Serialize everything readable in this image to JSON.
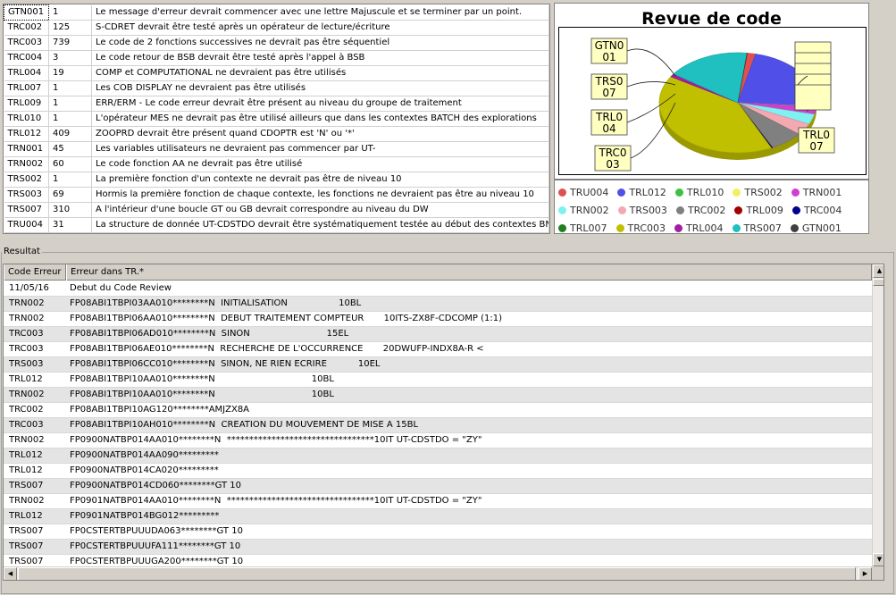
{
  "rules": [
    {
      "code": "GTN001",
      "count": "1",
      "message": "Le message d'erreur devrait commencer avec une lettre Majuscule et se terminer par un point."
    },
    {
      "code": "TRC002",
      "count": "125",
      "message": "S-CDRET devrait être testé après un opérateur de lecture/écriture"
    },
    {
      "code": "TRC003",
      "count": "739",
      "message": "Le code de 2 fonctions successives ne devrait pas être séquentiel"
    },
    {
      "code": "TRC004",
      "count": "3",
      "message": "Le code retour de BSB devrait être testé après l'appel à BSB"
    },
    {
      "code": "TRL004",
      "count": "19",
      "message": "COMP et COMPUTATIONAL ne devraient pas être utilisés"
    },
    {
      "code": "TRL007",
      "count": "1",
      "message": "Les COB DISPLAY ne devraient pas être utilisés"
    },
    {
      "code": "TRL009",
      "count": "1",
      "message": "ERR/ERM - Le code erreur devrait être présent au niveau du groupe de traitement"
    },
    {
      "code": "TRL010",
      "count": "1",
      "message": "L'opérateur MES ne devrait pas être utilisé ailleurs que dans les contextes BATCH des explorations"
    },
    {
      "code": "TRL012",
      "count": "409",
      "message": "ZOOPRD devrait être présent quand CDOPTR est 'N' ou '*'"
    },
    {
      "code": "TRN001",
      "count": "45",
      "message": "Les variables utilisateurs ne devraient pas commencer par UT-"
    },
    {
      "code": "TRN002",
      "count": "60",
      "message": "Le code fonction AA ne devrait pas être utilisé"
    },
    {
      "code": "TRS002",
      "count": "1",
      "message": "La première fonction d'un contexte ne devrait pas être de niveau 10"
    },
    {
      "code": "TRS003",
      "count": "69",
      "message": "Hormis la première fonction de chaque contexte, les fonctions ne devraient pas être au niveau 10"
    },
    {
      "code": "TRS007",
      "count": "310",
      "message": "A l'intérieur d'une boucle GT ou GB devrait correspondre au niveau du DW"
    },
    {
      "code": "TRU004",
      "count": "31",
      "message": "La structure de donnée UT-CDSTDO devrait être systématiquement testée au début des contextes BNK"
    }
  ],
  "chart_data": {
    "type": "pie",
    "title": "Revue de code",
    "series": [
      {
        "name": "TRU004",
        "value": 31,
        "color": "#e05050"
      },
      {
        "name": "TRL012",
        "value": 409,
        "color": "#5050e8"
      },
      {
        "name": "TRL010",
        "value": 1,
        "color": "#40c040"
      },
      {
        "name": "TRS002",
        "value": 1,
        "color": "#f0f060"
      },
      {
        "name": "TRN001",
        "value": 45,
        "color": "#d040d0"
      },
      {
        "name": "TRN002",
        "value": 60,
        "color": "#80f0f0"
      },
      {
        "name": "TRS003",
        "value": 69,
        "color": "#f4a8b0"
      },
      {
        "name": "TRC002",
        "value": 125,
        "color": "#808080"
      },
      {
        "name": "TRL009",
        "value": 1,
        "color": "#a00000"
      },
      {
        "name": "TRC004",
        "value": 3,
        "color": "#000090"
      },
      {
        "name": "TRL007",
        "value": 1,
        "color": "#208020"
      },
      {
        "name": "TRC003",
        "value": 739,
        "color": "#c0c000"
      },
      {
        "name": "TRL004",
        "value": 19,
        "color": "#a020a0"
      },
      {
        "name": "TRS007",
        "value": 310,
        "color": "#20c0c0"
      },
      {
        "name": "GTN001",
        "value": 1,
        "color": "#404040"
      }
    ],
    "callouts_left": [
      "GTN001",
      "TRS007",
      "TRL004",
      "TRC003"
    ],
    "callouts_right": [
      "TRL007",
      "",
      "",
      "",
      "",
      ""
    ],
    "legend_placement": "bottom"
  },
  "legend_rows": [
    [
      "TRU004",
      "TRL012",
      "TRL010",
      "TRS002",
      "TRN001"
    ],
    [
      "TRN002",
      "TRS003",
      "TRC002",
      "TRL009",
      "TRC004"
    ],
    [
      "TRL007",
      "TRC003",
      "TRL004",
      "TRS007",
      "GTN001"
    ]
  ],
  "result": {
    "group_label": "Resultat",
    "col_code": "Code Erreur",
    "col_error": "Erreur dans TR.*",
    "rows": [
      {
        "code": "11/05/16",
        "error": "Debut du Code Review"
      },
      {
        "code": "TRN002",
        "error": "FP08ABI1TBPI03AA010********N  INITIALISATION                  10BL"
      },
      {
        "code": "TRN002",
        "error": "FP08ABI1TBPI06AA010********N  DEBUT TRAITEMENT COMPTEUR       10ITS-ZX8F-CDCOMP (1:1)"
      },
      {
        "code": "TRC003",
        "error": "FP08ABI1TBPI06AD010********N  SINON                           15EL"
      },
      {
        "code": "TRC003",
        "error": "FP08ABI1TBPI06AE010********N  RECHERCHE DE L'OCCURRENCE       20DWUFP-INDX8A-R <"
      },
      {
        "code": "TRS003",
        "error": "FP08ABI1TBPI06CC010********N  SINON, NE RIEN ECRIRE           10EL"
      },
      {
        "code": "TRL012",
        "error": "FP08ABI1TBPI10AA010********N                                  10BL"
      },
      {
        "code": "TRN002",
        "error": "FP08ABI1TBPI10AA010********N                                  10BL"
      },
      {
        "code": "TRC002",
        "error": "FP08ABI1TBPI10AG120********AMJZX8A"
      },
      {
        "code": "TRC003",
        "error": "FP08ABI1TBPI10AH010********N  CREATION DU MOUVEMENT DE MISE A 15BL"
      },
      {
        "code": "TRN002",
        "error": "FP0900NATBP014AA010********N  *********************************10IT UT-CDSTDO = \"ZY\""
      },
      {
        "code": "TRL012",
        "error": "FP0900NATBP014AA090*********"
      },
      {
        "code": "TRL012",
        "error": "FP0900NATBP014CA020*********"
      },
      {
        "code": "TRS007",
        "error": "FP0900NATBP014CD060********GT 10"
      },
      {
        "code": "TRN002",
        "error": "FP0901NATBP014AA010********N  *********************************10IT UT-CDSTDO = \"ZY\""
      },
      {
        "code": "TRL012",
        "error": "FP0901NATBP014BG012*********"
      },
      {
        "code": "TRS007",
        "error": "FP0CSTERTBPUUUDA063********GT 10"
      },
      {
        "code": "TRS007",
        "error": "FP0CSTERTBPUUUFA111********GT 10"
      },
      {
        "code": "TRS007",
        "error": "FP0CSTERTBPUUUGA200********GT 10"
      }
    ]
  }
}
